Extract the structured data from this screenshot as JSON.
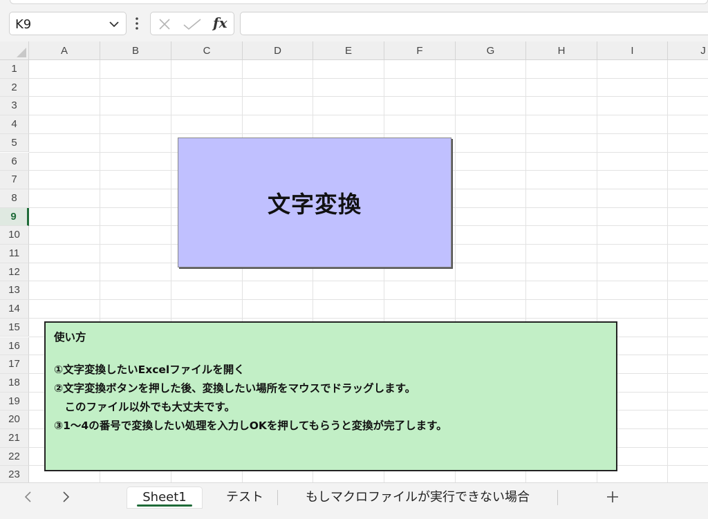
{
  "name_box": {
    "value": "K9"
  },
  "formula_bar": {
    "fx_label": "fx",
    "value": ""
  },
  "columns": [
    "A",
    "B",
    "C",
    "D",
    "E",
    "F",
    "G",
    "H",
    "I",
    "J"
  ],
  "rows": [
    "1",
    "2",
    "3",
    "4",
    "5",
    "6",
    "7",
    "8",
    "9",
    "10",
    "11",
    "12",
    "13",
    "14",
    "15",
    "16",
    "17",
    "18",
    "19",
    "20",
    "21",
    "22",
    "23"
  ],
  "active_row": "9",
  "button_shape": {
    "label": "文字変換",
    "color": "#c0c0ff"
  },
  "howto_box": {
    "color": "#c2efc6",
    "title": "使い方",
    "lines": [
      "①文字変換したいExcelファイルを開く",
      "②文字変換ボタンを押した後、変換したい場所をマウスでドラッグします。",
      "　このファイル以外でも大丈夫です。",
      "③1〜4の番号で変換したい処理を入力しOKを押してもらうと変換が完了します。"
    ]
  },
  "sheet_tabs": [
    {
      "label": "Sheet1",
      "active": true
    },
    {
      "label": "テスト",
      "active": false
    },
    {
      "label": "もしマクロファイルが実行できない場合",
      "active": false
    }
  ],
  "accent_color": "#1e6b38"
}
